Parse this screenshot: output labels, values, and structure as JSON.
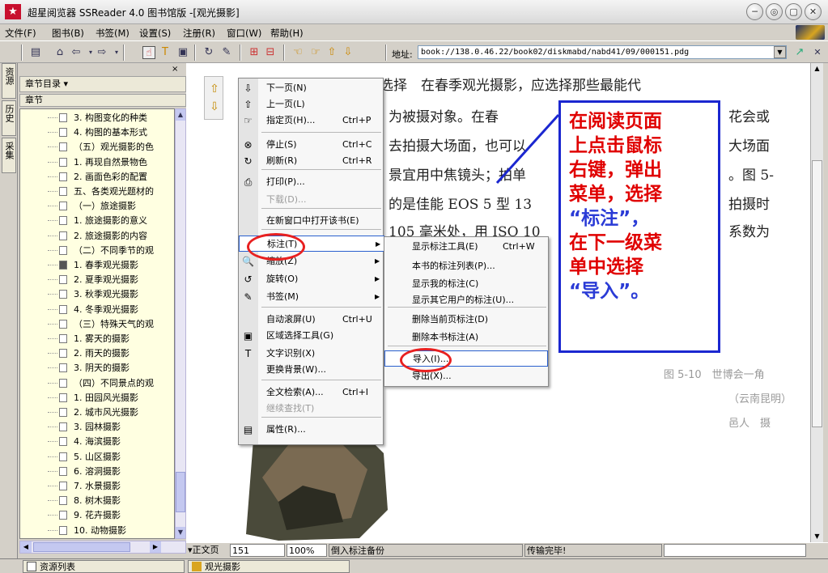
{
  "window": {
    "app_logo_text": "★",
    "title": "超星阅览器 SSReader 4.0 图书馆版 -[观光摄影]",
    "buttons": [
      "─",
      "◎",
      "▢",
      "✕"
    ]
  },
  "menubar": {
    "items": [
      "文件(F)",
      "图书(B)",
      "书签(M)",
      "设置(S)",
      "注册(R)",
      "窗口(W)",
      "帮助(H)"
    ]
  },
  "toolbar": {
    "address_label": "地址:",
    "address_value": "book://138.0.46.22/book02/diskmabd/nabd41/09/000151.pdg"
  },
  "vtabs": [
    "资源",
    "历史",
    "采集"
  ],
  "left_panel": {
    "close": "×",
    "header": "章节目录 ▾",
    "tree_header": "章节",
    "tree_items": [
      {
        "label": "3. 构图变化的种类",
        "indent": 1
      },
      {
        "label": "4. 构图的基本形式",
        "indent": 1
      },
      {
        "label": "（五）观光摄影的色",
        "indent": 0
      },
      {
        "label": "1. 再现自然景物色",
        "indent": 1
      },
      {
        "label": "2. 画面色彩的配置",
        "indent": 1
      },
      {
        "label": "五、各类观光题材的",
        "indent": 0
      },
      {
        "label": "（一）旅途摄影",
        "indent": 0
      },
      {
        "label": "1. 旅途摄影的意义",
        "indent": 1
      },
      {
        "label": "2. 旅途摄影的内容",
        "indent": 1
      },
      {
        "label": "（二）不同季节的观",
        "indent": 0
      },
      {
        "label": "1. 春季观光摄影",
        "indent": 1,
        "selected": true
      },
      {
        "label": "2. 夏季观光摄影",
        "indent": 1
      },
      {
        "label": "3. 秋季观光摄影",
        "indent": 1
      },
      {
        "label": "4. 冬季观光摄影",
        "indent": 1
      },
      {
        "label": "（三）特殊天气的观",
        "indent": 0
      },
      {
        "label": "1. 雾天的摄影",
        "indent": 1
      },
      {
        "label": "2. 雨天的摄影",
        "indent": 1
      },
      {
        "label": "3. 阴天的摄影",
        "indent": 1
      },
      {
        "label": "（四）不同景点的观",
        "indent": 0
      },
      {
        "label": "1. 田园风光摄影",
        "indent": 1
      },
      {
        "label": "2. 城市风光摄影",
        "indent": 1
      },
      {
        "label": "3. 园林摄影",
        "indent": 1
      },
      {
        "label": "4. 海滨摄影",
        "indent": 1
      },
      {
        "label": "5. 山区摄影",
        "indent": 1
      },
      {
        "label": "6. 溶洞摄影",
        "indent": 1
      },
      {
        "label": "7. 水景摄影",
        "indent": 1
      },
      {
        "label": "8. 树木摄影",
        "indent": 1
      },
      {
        "label": "9. 花卉摄影",
        "indent": 1
      },
      {
        "label": "10. 动物摄影",
        "indent": 1
      }
    ]
  },
  "page": {
    "text_lines": [
      "景物的选择　在春季观光摄影，应选择那些最能代",
      "为被摄对象。在春",
      "去拍摄大场面，也可以",
      "景宜用中焦镜头；拍单",
      "的是佳能 EOS 5 型 13",
      "105 毫米处，用 ISO 10"
    ],
    "right_text": [
      "花会或",
      "大场面",
      "。图 5-",
      "拍摄时",
      "系数为"
    ],
    "caption": [
      "图 5-10　世博会一角",
      "（云南昆明）",
      "邑人　摄"
    ]
  },
  "context_menu": {
    "items": [
      {
        "icon": "⇩",
        "label": "下一页(N)",
        "key": ""
      },
      {
        "icon": "⇧",
        "label": "上一页(L)",
        "key": ""
      },
      {
        "icon": "☞",
        "label": "指定页(H)...",
        "key": "Ctrl+P"
      },
      {
        "icon": "⊗",
        "label": "停止(S)",
        "key": "Ctrl+C"
      },
      {
        "icon": "↻",
        "label": "刷新(R)",
        "key": "Ctrl+R"
      },
      {
        "icon": "⎙",
        "label": "打印(P)...",
        "key": ""
      },
      {
        "icon": "",
        "label": "下载(D)...",
        "key": "",
        "disabled": true
      },
      {
        "icon": "",
        "label": "在新窗口中打开该书(E)",
        "key": ""
      },
      {
        "icon": "",
        "label": "标注(T)",
        "key": "",
        "submenu": true,
        "highlighted": true
      },
      {
        "icon": "🔍",
        "label": "缩放(Z)",
        "key": "",
        "submenu": true
      },
      {
        "icon": "↺",
        "label": "旋转(O)",
        "key": "",
        "submenu": true
      },
      {
        "icon": "✎",
        "label": "书签(M)",
        "key": "",
        "submenu": true
      },
      {
        "icon": "",
        "label": "自动滚屏(U)",
        "key": "Ctrl+U"
      },
      {
        "icon": "▣",
        "label": "区域选择工具(G)",
        "key": ""
      },
      {
        "icon": "T",
        "label": "文字识别(X)",
        "key": ""
      },
      {
        "icon": "",
        "label": "更换背景(W)...",
        "key": ""
      },
      {
        "icon": "",
        "label": "全文检索(A)...",
        "key": "Ctrl+I"
      },
      {
        "icon": "",
        "label": "继续查找(T)",
        "key": "",
        "disabled": true
      },
      {
        "icon": "▤",
        "label": "属性(R)...",
        "key": ""
      }
    ]
  },
  "submenu": {
    "items": [
      {
        "label": "显示标注工具(E)",
        "key": "Ctrl+W"
      },
      {
        "label": "本书的标注列表(P)...",
        "key": ""
      },
      {
        "label": "显示我的标注(C)",
        "key": ""
      },
      {
        "label": "显示其它用户的标注(U)...",
        "key": ""
      },
      {
        "label": "删除当前页标注(D)",
        "key": ""
      },
      {
        "label": "删除本书标注(A)",
        "key": ""
      },
      {
        "label": "导入(I)...",
        "key": "",
        "highlighted": true
      },
      {
        "label": "导出(X)...",
        "key": ""
      }
    ]
  },
  "callout": {
    "lines": [
      "在阅读页面",
      "上点击鼠标",
      "右键，弹出",
      "菜单，选择",
      "“标注”，",
      "在下一级菜",
      "单中选择",
      "“导入”。"
    ],
    "accent_color": "#e00000",
    "border_color": "#1b27d0"
  },
  "statusbar": {
    "page_prefix": "▾正文页",
    "page_num": "151",
    "zoom": "100%",
    "status": "倒入标注备份",
    "transfer": "传输完毕!"
  },
  "bottom_bar": {
    "tabs": [
      "资源列表",
      "观光摄影"
    ]
  }
}
